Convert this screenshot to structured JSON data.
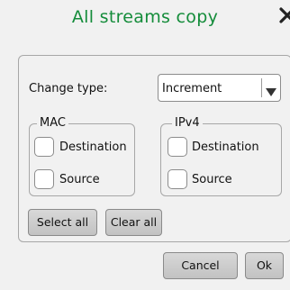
{
  "dialog": {
    "title": "All streams copy",
    "close_icon": "close-icon"
  },
  "change_type": {
    "label": "Change type:",
    "selected": "Increment"
  },
  "mac_group": {
    "legend": "MAC",
    "options": [
      {
        "label": "Destination",
        "checked": false
      },
      {
        "label": "Source",
        "checked": false
      }
    ]
  },
  "ipv4_group": {
    "legend": "IPv4",
    "options": [
      {
        "label": "Destination",
        "checked": false
      },
      {
        "label": "Source",
        "checked": false
      }
    ]
  },
  "buttons": {
    "select_all": "Select all",
    "clear_all": "Clear all",
    "cancel": "Cancel",
    "ok": "Ok"
  },
  "colors": {
    "title": "#148c3a",
    "background": "#f1f1f1",
    "button": "#c8c8c8"
  }
}
